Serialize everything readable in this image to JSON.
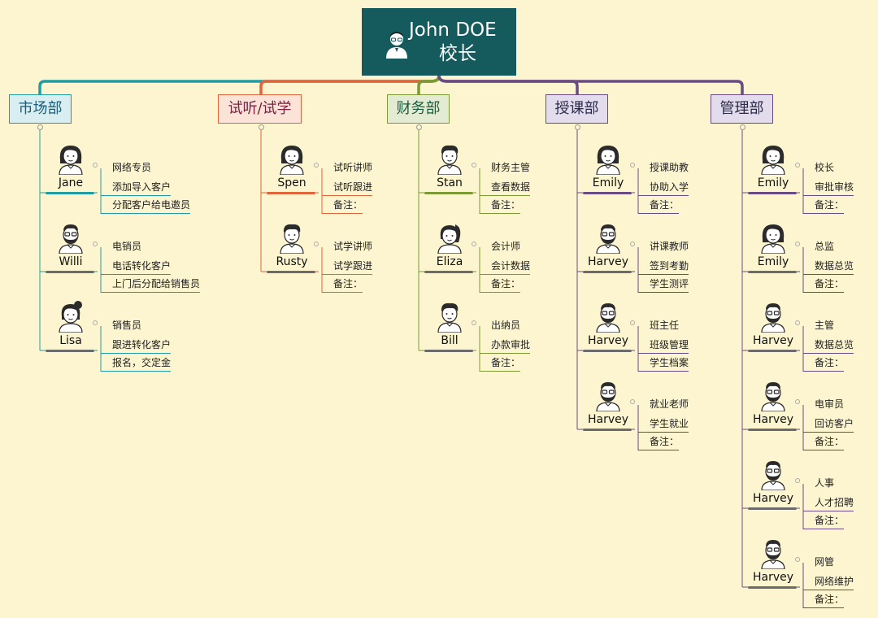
{
  "root": {
    "name": "John DOE",
    "title": "校长"
  },
  "departments": [
    {
      "name": "市场部",
      "color": "#1f9ea2",
      "boxBg": "#d9eef0",
      "textColor": "#1a5c7a",
      "members": [
        {
          "name": "Jane",
          "avatar": "female-avatar-icon",
          "role": "网络专员",
          "tasks": [
            "添加导入客户",
            "分配客户给电邀员"
          ]
        },
        {
          "name": "Willi",
          "avatar": "male-bearded-avatar-icon",
          "role": "电销员",
          "tasks": [
            "电话转化客户",
            "上门后分配给销售员"
          ]
        },
        {
          "name": "Lisa",
          "avatar": "female-bun-avatar-icon",
          "role": "销售员",
          "tasks": [
            "跟进转化客户",
            "报名，交定金"
          ]
        }
      ]
    },
    {
      "name": "试听/试学",
      "color": "#e0653a",
      "boxBg": "#fbe3d8",
      "textColor": "#7a2040",
      "members": [
        {
          "name": "Spen",
          "avatar": "female-avatar-icon",
          "role": "试听讲师",
          "tasks": [
            "试听跟进",
            "备注："
          ]
        },
        {
          "name": "Rusty",
          "avatar": "male-avatar-icon",
          "role": "试学讲师",
          "tasks": [
            "试学跟进",
            "备注："
          ]
        }
      ]
    },
    {
      "name": "财务部",
      "color": "#7b9a33",
      "boxBg": "#e3ecd2",
      "textColor": "#1a5c40",
      "members": [
        {
          "name": "Stan",
          "avatar": "male-avatar-icon",
          "role": "财务主管",
          "tasks": [
            "查看数据",
            "备注："
          ]
        },
        {
          "name": "Eliza",
          "avatar": "female-ponytail-avatar-icon",
          "role": "会计师",
          "tasks": [
            "会计数据",
            "备注："
          ]
        },
        {
          "name": "Bill",
          "avatar": "male-avatar-icon",
          "role": "出纳员",
          "tasks": [
            "办款审批",
            "备注："
          ]
        }
      ]
    },
    {
      "name": "授课部",
      "color": "#6a4a82",
      "boxBg": "#e3dcec",
      "textColor": "#2a2a4a",
      "members": [
        {
          "name": "Emily",
          "avatar": "female-avatar-icon",
          "role": "授课助教",
          "tasks": [
            "协助入学",
            "备注："
          ]
        },
        {
          "name": "Harvey",
          "avatar": "male-bearded-avatar-icon",
          "role": "讲课教师",
          "tasks": [
            "签到考勤",
            "学生测评"
          ]
        },
        {
          "name": "Harvey",
          "avatar": "male-bearded-avatar-icon",
          "role": "班主任",
          "tasks": [
            "班级管理",
            "学生档案"
          ]
        },
        {
          "name": "Harvey",
          "avatar": "male-bearded-avatar-icon",
          "role": "就业老师",
          "tasks": [
            "学生就业",
            "备注："
          ]
        }
      ]
    },
    {
      "name": "管理部",
      "color": "#6a4a82",
      "boxBg": "#e3dcec",
      "textColor": "#2a2a4a",
      "members": [
        {
          "name": "Emily",
          "avatar": "female-avatar-icon",
          "role": "校长",
          "tasks": [
            "审批审核",
            "备注："
          ]
        },
        {
          "name": "Emily",
          "avatar": "female-avatar-icon",
          "role": "总监",
          "tasks": [
            "数据总览",
            "备注："
          ]
        },
        {
          "name": "Harvey",
          "avatar": "male-bearded-avatar-icon",
          "role": "主管",
          "tasks": [
            "数据总览",
            "备注："
          ]
        },
        {
          "name": "Harvey",
          "avatar": "male-bearded-avatar-icon",
          "role": "电审员",
          "tasks": [
            "回访客户",
            "备注："
          ]
        },
        {
          "name": "Harvey",
          "avatar": "male-bearded-avatar-icon",
          "role": "人事",
          "tasks": [
            "人才招聘",
            "备注："
          ]
        },
        {
          "name": "Harvey",
          "avatar": "male-bearded-avatar-icon",
          "role": "网管",
          "tasks": [
            "网络维护",
            "备注："
          ]
        }
      ]
    }
  ]
}
